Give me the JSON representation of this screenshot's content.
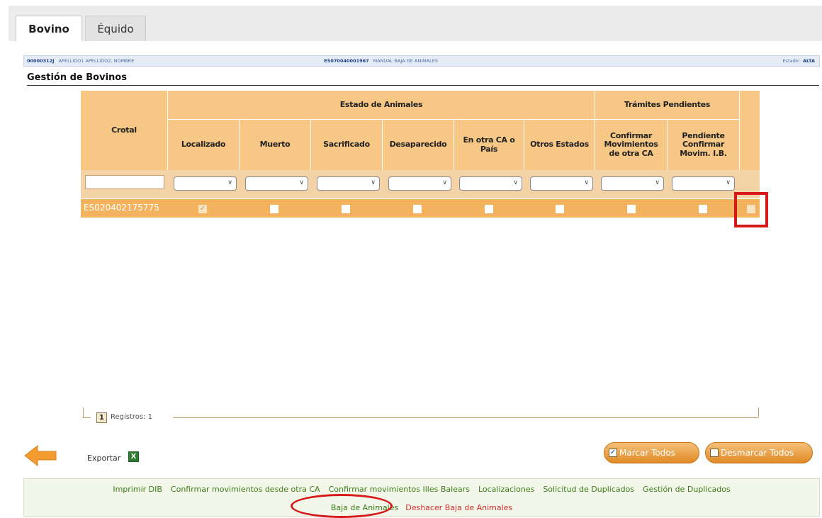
{
  "tabs": [
    {
      "label": "Bovino",
      "active": true
    },
    {
      "label": "Équido",
      "active": false
    }
  ],
  "infobar": {
    "holder_id": "00000312J",
    "holder_name": "APELLIDO1 APELLIDO2, NOMBRE",
    "farm_code": "ES070040001967",
    "farm_desc": "MANUAL BAJA DE ANIMALES",
    "status_label": "Estado:",
    "status_value": "ALTA"
  },
  "section_title": "Gestión de Bovinos",
  "grid": {
    "header_groups": {
      "estado": "Estado de Animales",
      "tramites": "Trámites Pendientes"
    },
    "columns": {
      "crotal": "Crotal",
      "localizado": "Localizado",
      "muerto": "Muerto",
      "sacrificado": "Sacrificado",
      "desaparecido": "Desaparecido",
      "otra_ca": "En otra CA o País",
      "otros": "Otros Estados",
      "confirmar": "Confirmar Movimientos de otra CA",
      "pendiente": "Pendiente Confirmar Movim. I.B."
    },
    "rows": [
      {
        "crotal": "ES020402175775",
        "localizado": true,
        "muerto": false,
        "sacrificado": false,
        "desaparecido": false,
        "otra_ca": false,
        "otros": false,
        "confirmar": false,
        "pendiente": false,
        "select": false
      }
    ]
  },
  "pager": {
    "page": "1",
    "records": "Registros: 1"
  },
  "actions": {
    "export_label": "Exportar",
    "export_icon": "excel-icon",
    "back_icon": "arrow-left-icon",
    "mark_all": "Marcar Todos",
    "unmark_all": "Desmarcar Todos"
  },
  "footer": {
    "links_row1": [
      "Imprimir DIB",
      "Confirmar movimientos desde otra CA",
      "Confirmar movimientos Illes Balears",
      "Localizaciones",
      "Solicitud de Duplicados",
      "Gestión de Duplicados"
    ],
    "baja": "Baja de Animales",
    "deshacer": "Deshacer Baja de Animales"
  },
  "colors": {
    "header": "#f6c785",
    "row": "#f3b25e",
    "accent": "#e08a25",
    "link_green": "#3e7d1a",
    "link_red": "#d62d2d",
    "highlight": "#d61a1a"
  }
}
